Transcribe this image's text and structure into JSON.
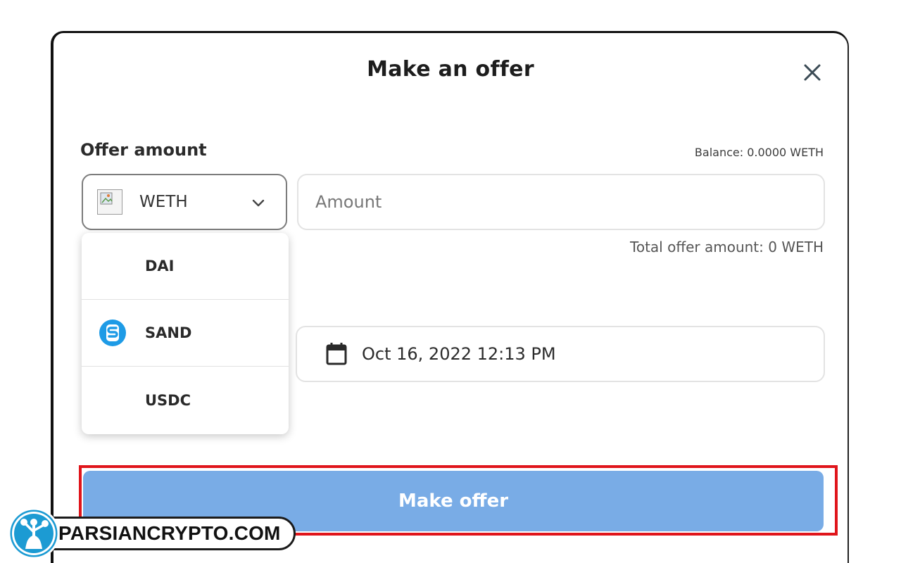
{
  "modal": {
    "title": "Make an offer"
  },
  "offer": {
    "label": "Offer amount",
    "balance": "Balance: 0.0000 WETH",
    "selected_currency": "WETH",
    "amount_placeholder": "Amount",
    "amount_value": "",
    "total": "Total offer amount: 0 WETH"
  },
  "currency_options": [
    {
      "label": "DAI",
      "icon": ""
    },
    {
      "label": "SAND",
      "icon": "sand-token-icon"
    },
    {
      "label": "USDC",
      "icon": ""
    }
  ],
  "expiration": {
    "date": "Oct 16, 2022 12:13 PM",
    "icon": "calendar-icon"
  },
  "submit": {
    "label": "Make offer",
    "color": "#79ace6",
    "highlight_color": "#e0151b"
  },
  "watermark": {
    "text": "PARSIANCRYPTO.COM"
  },
  "colors": {
    "sand_blue": "#1e9be6"
  }
}
